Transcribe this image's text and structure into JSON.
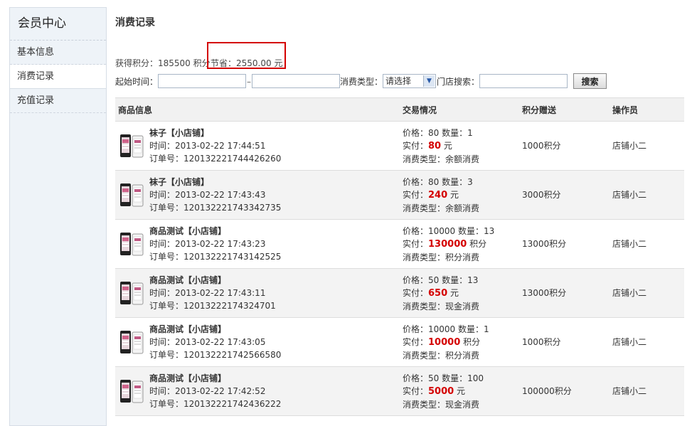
{
  "sidebar": {
    "title": "会员中心",
    "items": [
      {
        "label": "基本信息",
        "active": false
      },
      {
        "label": "消费记录",
        "active": true
      },
      {
        "label": "充值记录",
        "active": false
      }
    ]
  },
  "main": {
    "title": "消费记录",
    "stats_points": "获得积分：185500 积分",
    "stats_saving": "节省：2550.00 元",
    "filters": {
      "start_label": "起始时间：",
      "separator": "–",
      "type_label": "消费类型：",
      "type_selected": "请选择",
      "store_label": "门店搜索：",
      "search_button": "搜索"
    },
    "columns": [
      "商品信息",
      "交易情况",
      "积分赠送",
      "操作员"
    ],
    "rows": [
      {
        "name": "袜子【小店铺】",
        "time": "时间：2013-02-22 17:44:51",
        "order": "订单号：120132221744426260",
        "price_line": "价格：80  数量：1",
        "paid_prefix": "实付：",
        "paid": "80",
        "paid_unit": " 元",
        "type": "消费类型：余额消费",
        "points": "1000积分",
        "operator": "店铺小二"
      },
      {
        "name": "袜子【小店铺】",
        "time": "时间：2013-02-22 17:43:43",
        "order": "订单号：120132221743342735",
        "price_line": "价格：80  数量：3",
        "paid_prefix": "实付：",
        "paid": "240",
        "paid_unit": " 元",
        "type": "消费类型：余额消费",
        "points": "3000积分",
        "operator": "店铺小二"
      },
      {
        "name": "商品测试【小店铺】",
        "time": "时间：2013-02-22 17:43:23",
        "order": "订单号：120132221743142525",
        "price_line": "价格：10000  数量：13",
        "paid_prefix": "实付：",
        "paid": "130000",
        "paid_unit": " 积分",
        "type": "消费类型：积分消费",
        "points": "13000积分",
        "operator": "店铺小二"
      },
      {
        "name": "商品测试【小店铺】",
        "time": "时间：2013-02-22 17:43:11",
        "order": "订单号：12013222174324701",
        "price_line": "价格：50  数量：13",
        "paid_prefix": "实付：",
        "paid": "650",
        "paid_unit": " 元",
        "type": "消费类型：现金消费",
        "points": "13000积分",
        "operator": "店铺小二"
      },
      {
        "name": "商品测试【小店铺】",
        "time": "时间：2013-02-22 17:43:05",
        "order": "订单号：120132221742566580",
        "price_line": "价格：10000  数量：1",
        "paid_prefix": "实付：",
        "paid": "10000",
        "paid_unit": " 积分",
        "type": "消费类型：积分消费",
        "points": "1000积分",
        "operator": "店铺小二"
      },
      {
        "name": "商品测试【小店铺】",
        "time": "时间：2013-02-22 17:42:52",
        "order": "订单号：120132221742436222",
        "price_line": "价格：50  数量：100",
        "paid_prefix": "实付：",
        "paid": "5000",
        "paid_unit": " 元",
        "type": "消费类型：现金消费",
        "points": "100000积分",
        "operator": "店铺小二"
      }
    ]
  }
}
